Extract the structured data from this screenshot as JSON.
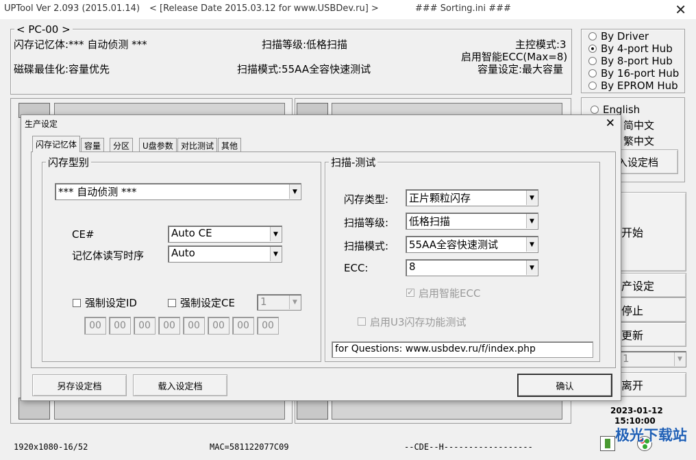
{
  "app": {
    "title": "UPTool Ver 2.093 (2015.01.14)",
    "release": "< [Release Date 2015.03.12 for www.USBDev.ru] >",
    "ini": "### Sorting.ini ###"
  },
  "info": {
    "group": "< PC-00 >",
    "flash_memory": "闪存记忆体:*** 自动侦测 ***",
    "scan_level": "扫描等级:低格扫描",
    "host_mode": "主控模式:3",
    "ecc": "启用智能ECC(Max=8)",
    "disk_opt": "磁碟最佳化:容量优先",
    "scan_mode": "扫描模式:55AA全容快速测试",
    "capacity": "容量设定:最大容量"
  },
  "hub_options": [
    {
      "label": "By Driver",
      "selected": false
    },
    {
      "label": "By 4-port Hub",
      "selected": true
    },
    {
      "label": "By 8-port Hub",
      "selected": false
    },
    {
      "label": "By 16-port Hub",
      "selected": false
    },
    {
      "label": "By EPROM Hub",
      "selected": false
    }
  ],
  "language": {
    "english": "English",
    "simplified": "简中文",
    "traditional": "繁中文"
  },
  "right_buttons": {
    "load_config": "入设定档",
    "start": "开始",
    "prod_settings": "产设定",
    "stop": "停止",
    "update": "更新",
    "combo_value": "1",
    "exit": "离开"
  },
  "datetime": {
    "date": "2023-01-12",
    "time": "15:10:00"
  },
  "status_bar": {
    "resolution": "1920x1080-16/52",
    "mac": "MAC=581122077C09",
    "cde": "--CDE--H------------------",
    "watermark": "极光下载站"
  },
  "dialog": {
    "title": "生产设定",
    "close": "×",
    "tabs": [
      "闪存记忆体",
      "容量",
      "分区",
      "U盘参数",
      "对比测试",
      "其他"
    ],
    "flash_group": {
      "label": "闪存型别",
      "flash_type": "*** 自动侦测 ***",
      "ce_label": "CE#",
      "ce_value": "Auto CE",
      "timing_label": "记忆体读写时序",
      "timing_value": "Auto",
      "force_id_label": "强制设定ID",
      "force_ce_label": "强制设定CE",
      "force_ce_value": "1",
      "id_bytes": [
        "00",
        "00",
        "00",
        "00",
        "00",
        "00",
        "00",
        "00"
      ]
    },
    "scan_group": {
      "label": "扫描-测试",
      "flash_kind_label": "闪存类型:",
      "flash_kind_value": "正片颗粒闪存",
      "scan_level_label": "扫描等级:",
      "scan_level_value": "低格扫描",
      "scan_mode_label": "扫描模式:",
      "scan_mode_value": "55AA全容快速测试",
      "ecc_label": "ECC:",
      "ecc_value": "8",
      "smart_ecc": "启用智能ECC",
      "u3_test": "启用U3闪存功能测试",
      "questions": "for Questions: www.usbdev.ru/f/index.php"
    },
    "buttons": {
      "save": "另存设定档",
      "load": "载入设定档",
      "ok": "确认"
    }
  }
}
